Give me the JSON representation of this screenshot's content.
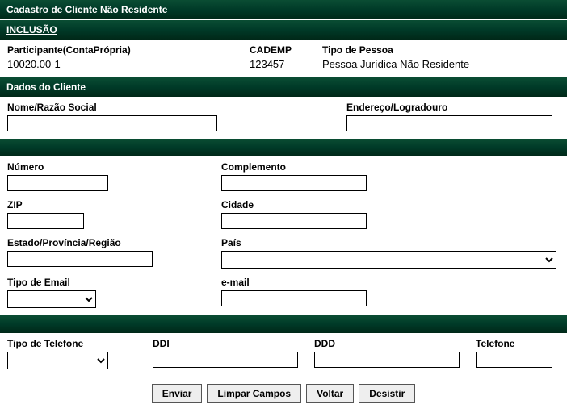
{
  "title": "Cadastro de Cliente Não Residente",
  "operation": "INCLUSÃO",
  "info": {
    "participante_label": "Participante(ContaPrópria)",
    "participante_value": "10020.00-1",
    "cademp_label": "CADEMP",
    "cademp_value": "123457",
    "tipo_pessoa_label": "Tipo de Pessoa",
    "tipo_pessoa_value": "Pessoa Jurídica Não Residente"
  },
  "section_dados": "Dados do Cliente",
  "labels": {
    "nome": "Nome/Razão Social",
    "endereco": "Endereço/Logradouro",
    "numero": "Número",
    "complemento": "Complemento",
    "zip": "ZIP",
    "cidade": "Cidade",
    "estado": "Estado/Província/Região",
    "pais": "País",
    "tipo_email": "Tipo de Email",
    "email": "e-mail",
    "tipo_telefone": "Tipo de Telefone",
    "ddi": "DDI",
    "ddd": "DDD",
    "telefone": "Telefone"
  },
  "buttons": {
    "enviar": "Enviar",
    "limpar": "Limpar Campos",
    "voltar": "Voltar",
    "desistir": "Desistir"
  }
}
